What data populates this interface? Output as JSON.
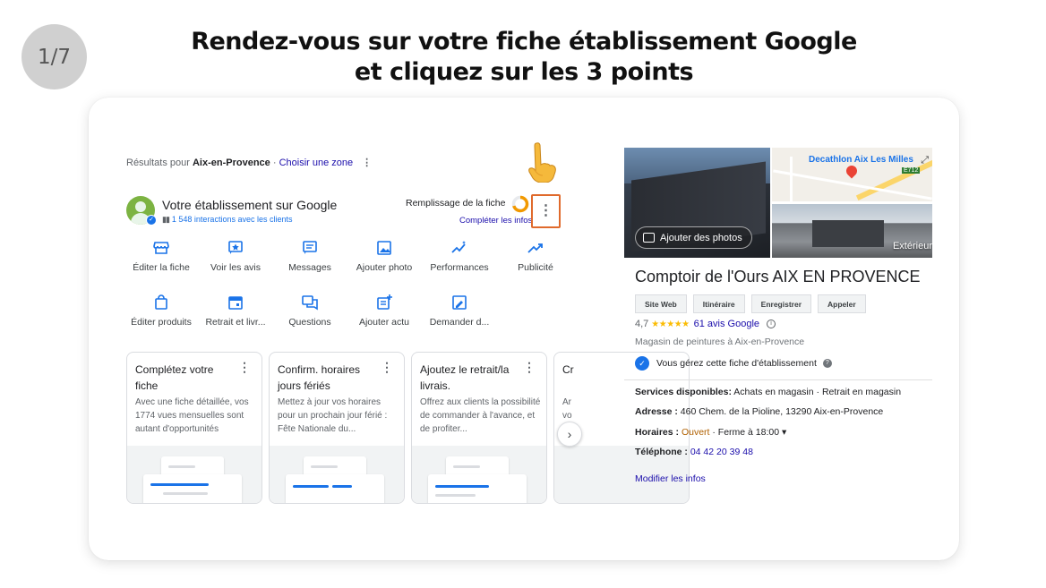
{
  "slide": {
    "step": "1/7",
    "title_line1": "Rendez-vous sur votre fiche établissement Google",
    "title_line2": "et cliquez sur les 3 points"
  },
  "left": {
    "results_prefix": "Résultats pour ",
    "results_location": "Aix-en-Provence",
    "results_sep": " · ",
    "choose_zone": "Choisir une zone",
    "results_menu": "⋮",
    "business_title": "Votre établissement sur Google",
    "interactions": "1 548 interactions avec les clients",
    "fill_label": "Remplissage de la fiche",
    "complete_link": "Compléter les infos",
    "menu_dots": "⋮",
    "actions": [
      {
        "label": "Éditer la fiche",
        "icon": "storefront-icon"
      },
      {
        "label": "Voir les avis",
        "icon": "star-review-icon"
      },
      {
        "label": "Messages",
        "icon": "message-icon"
      },
      {
        "label": "Ajouter photo",
        "icon": "photo-icon"
      },
      {
        "label": "Performances",
        "icon": "performance-icon"
      },
      {
        "label": "Publicité",
        "icon": "trend-icon"
      },
      {
        "label": "Éditer produits",
        "icon": "shopping-bag-icon"
      },
      {
        "label": "Retrait et livr...",
        "icon": "calendar-icon"
      },
      {
        "label": "Questions",
        "icon": "questions-icon"
      },
      {
        "label": "Ajouter actu",
        "icon": "post-add-icon"
      },
      {
        "label": "Demander d...",
        "icon": "request-review-icon"
      }
    ],
    "tasks": [
      {
        "title": "Complétez votre fiche",
        "desc": "Avec une fiche détaillée, vos 1774 vues mensuelles sont autant d'opportunités"
      },
      {
        "title": "Confirm. horaires jours fériés",
        "desc": "Mettez à jour vos horaires pour un prochain jour férié : Fête Nationale du..."
      },
      {
        "title": "Ajoutez le retrait/la livrais.",
        "desc": "Offrez aux clients la possibilité de commander à l'avance, et de profiter..."
      },
      {
        "title": "Cr",
        "desc": "Ar\nvo"
      }
    ],
    "task_menu": "⋮",
    "next": "›"
  },
  "right": {
    "add_photos": "Ajouter des photos",
    "map_label": "Decathlon Aix Les Milles",
    "map_shield": "E712",
    "exterior": "Extérieur",
    "place_name": "Comptoir de l'Ours AIX EN PROVENCE",
    "buttons": [
      "Site Web",
      "Itinéraire",
      "Enregistrer",
      "Appeler"
    ],
    "rating": "4,7",
    "stars": "★★★★★",
    "reviews": "61 avis Google",
    "category": "Magasin de peintures à Aix-en-Provence",
    "managed": "Vous gérez cette fiche d'établissement",
    "services_label": "Services disponibles:",
    "services_value": " Achats en magasin · Retrait en magasin",
    "address_label": "Adresse :",
    "address_value": " 460 Chem. de la Pioline, 13290 Aix-en-Provence",
    "hours_label": "Horaires :",
    "hours_open": " Ouvert",
    "hours_rest": " · Ferme à 18:00 ▾",
    "phone_label": "Téléphone :",
    "phone_value": " 04 42 20 39 48",
    "modify": "Modifier les infos"
  },
  "colors": {
    "highlight": "#e06a2c",
    "link": "#1a0dab",
    "google_blue": "#1a73e8",
    "star": "#fbbc04"
  }
}
